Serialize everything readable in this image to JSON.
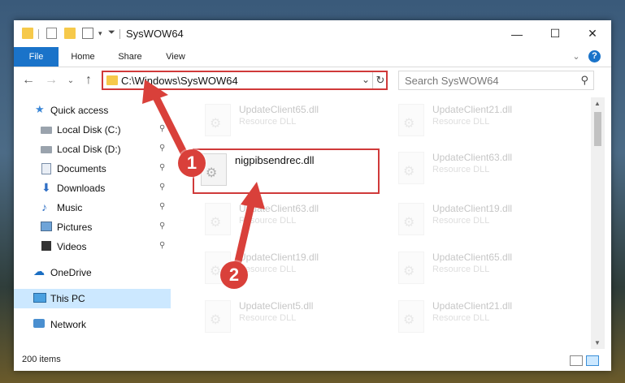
{
  "window": {
    "title": "SysWOW64",
    "controls": {
      "minimize": "—",
      "maximize": "☐",
      "close": "✕"
    }
  },
  "ribbon": {
    "tabs": [
      "File",
      "Home",
      "Share",
      "View"
    ],
    "expand": "⌄",
    "help": "?"
  },
  "address_bar": {
    "path": "C:\\Windows\\SysWOW64",
    "dropdown": "⌄",
    "refresh": "↻"
  },
  "nav_buttons": {
    "back": "←",
    "forward": "→",
    "recent": "⌄",
    "up": "↑"
  },
  "search": {
    "placeholder": "Search SysWOW64",
    "icon": "⚲"
  },
  "sidebar": {
    "quick_access": "Quick access",
    "items": [
      {
        "label": "Local Disk (C:)",
        "icon": "disk-icon",
        "pinned": true
      },
      {
        "label": "Local Disk (D:)",
        "icon": "disk-icon",
        "pinned": true
      },
      {
        "label": "Documents",
        "icon": "documents-icon",
        "pinned": true
      },
      {
        "label": "Downloads",
        "icon": "downloads-icon",
        "pinned": true
      },
      {
        "label": "Music",
        "icon": "music-icon",
        "pinned": true
      },
      {
        "label": "Pictures",
        "icon": "pictures-icon",
        "pinned": true
      },
      {
        "label": "Videos",
        "icon": "videos-icon",
        "pinned": true
      }
    ],
    "onedrive": "OneDrive",
    "this_pc": "This PC",
    "network": "Network",
    "pin_glyph": "📌"
  },
  "files": {
    "highlighted": {
      "name": "nigpibsendrec.dll"
    },
    "left_column": [
      {
        "name": "UpdateClient65.dll",
        "type": "Resource DLL"
      },
      {
        "name": "UpdateClient63.dll",
        "type": "Resource DLL"
      },
      {
        "name": "UpdateClient19.dll",
        "type": "Resource DLL"
      },
      {
        "name": "UpdateClient5.dll",
        "type": "Resource DLL"
      }
    ],
    "right_column": [
      {
        "name": "UpdateClient21.dll",
        "type": "Resource DLL"
      },
      {
        "name": "UpdateClient63.dll",
        "type": "Resource DLL"
      },
      {
        "name": "UpdateClient19.dll",
        "type": "Resource DLL"
      },
      {
        "name": "UpdateClient65.dll",
        "type": "Resource DLL"
      },
      {
        "name": "UpdateClient21.dll",
        "type": "Resource DLL"
      }
    ]
  },
  "status": {
    "item_count": "200 items"
  },
  "annotations": {
    "step1": "1",
    "step2": "2",
    "color": "#d9403a"
  }
}
